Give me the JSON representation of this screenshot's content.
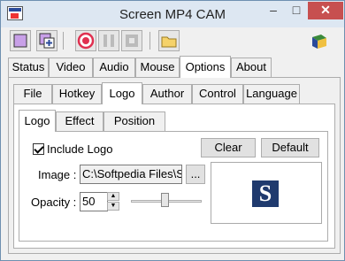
{
  "window": {
    "title": "Screen MP4 CAM"
  },
  "titlebar": {
    "minimize_glyph": "–",
    "maximize_glyph": "□",
    "close_glyph": "✕"
  },
  "toolbar": {
    "icons": [
      "region-select-icon",
      "add-region-icon",
      "record-icon",
      "pause-icon",
      "stop-icon",
      "open-folder-icon",
      "help-book-icon"
    ]
  },
  "main_tabs": [
    "Status",
    "Video",
    "Audio",
    "Mouse",
    "Options",
    "About"
  ],
  "main_tabs_active": "Options",
  "options_tabs": [
    "File",
    "Hotkey",
    "Logo",
    "Author",
    "Control",
    "Language"
  ],
  "options_tabs_active": "Logo",
  "logo_tabs": [
    "Logo",
    "Effect",
    "Position"
  ],
  "logo_tabs_active": "Logo",
  "logo": {
    "include_label": "Include Logo",
    "include_checked": true,
    "clear_label": "Clear",
    "default_label": "Default",
    "image_label": "Image :",
    "image_path": "C:\\Softpedia Files\\So",
    "browse_label": "...",
    "opacity_label": "Opacity :",
    "opacity_value": "50",
    "preview_letter": "S"
  },
  "colors": {
    "accent": "#2a4a9a",
    "logo_bg": "#1f3a6e"
  }
}
